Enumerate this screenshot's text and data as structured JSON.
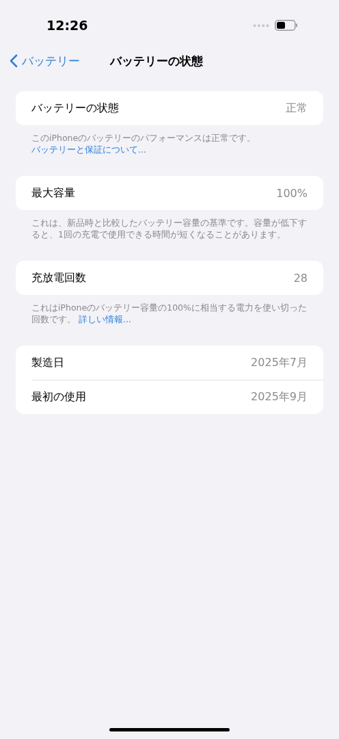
{
  "status_bar": {
    "time": "12:26"
  },
  "nav": {
    "back": "バッテリー",
    "title": "バッテリーの状態"
  },
  "groups": [
    {
      "rows": [
        {
          "label": "バッテリーの状態",
          "value": "正常"
        }
      ],
      "footer": {
        "text": "このiPhoneのバッテリーのパフォーマンスは正常です。",
        "link": "バッテリーと保証について..."
      }
    },
    {
      "rows": [
        {
          "label": "最大容量",
          "value": "100%"
        }
      ],
      "footer": {
        "text": "これは、新品時と比較したバッテリー容量の基準です。容量が低下すると、1回の充電で使用できる時間が短くなることがあります。"
      }
    },
    {
      "rows": [
        {
          "label": "充放電回数",
          "value": "28"
        }
      ],
      "footer": {
        "text": "これはiPhoneのバッテリー容量の100%に相当する電力を使い切った回数です。",
        "link": "詳しい情報..."
      }
    },
    {
      "rows": [
        {
          "label": "製造日",
          "value": "2025年7月"
        },
        {
          "label": "最初の使用",
          "value": "2025年9月"
        }
      ]
    }
  ]
}
